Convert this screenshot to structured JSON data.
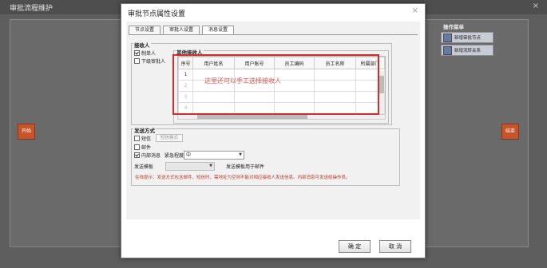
{
  "background": {
    "window_title": "审批流程维护",
    "close_symbol": "×",
    "start_node": "开始",
    "end_node": "结束",
    "op_menu": {
      "title": "操作菜单",
      "items": [
        {
          "label": "新增审批节点",
          "icon": "node-icon"
        },
        {
          "label": "新增流转关系",
          "icon": "link-icon"
        }
      ]
    }
  },
  "dialog": {
    "title": "审批节点属性设置",
    "close_symbol": "×",
    "tabs": [
      {
        "label": "节点设置",
        "active": false
      },
      {
        "label": "审批人设置",
        "active": false
      },
      {
        "label": "消息设置",
        "active": true
      }
    ],
    "receivers": {
      "legend": "接收人",
      "maker_label": "制单人",
      "maker_checked": true,
      "next_approver_label": "下级审批人",
      "next_approver_checked": false,
      "other": {
        "legend": "其他接收人",
        "columns": [
          "序号",
          "用户姓名",
          "用户账号",
          "员工编码",
          "员工名称",
          "所属部门"
        ],
        "rows": [
          [
            "1",
            "",
            "",
            "",
            "",
            ""
          ],
          [
            "2",
            "",
            "",
            "",
            "",
            ""
          ],
          [
            "3",
            "",
            "",
            "",
            "",
            ""
          ],
          [
            "4",
            "",
            "",
            "",
            "",
            ""
          ]
        ],
        "annotation": "这里还可以手工选择接收人"
      }
    },
    "send_method": {
      "legend": "发送方式",
      "sms_label": "短信",
      "sms_checked": false,
      "sms_format_button": "短信格式",
      "email_label": "邮件",
      "email_checked": false,
      "internal_label": "内部消息",
      "internal_checked": true,
      "urgency_label": "紧急程度",
      "urgency_value": "中",
      "template_label": "发送模板",
      "template_value": "",
      "template_note": "发送模板用于邮件",
      "hint": "在线提示：发送方式包含邮件，短信时，需地址为空则不能对相应接收人发送信息。内部消息可发送给操作员。"
    },
    "buttons": {
      "ok": "确  定",
      "cancel": "取  消"
    }
  }
}
